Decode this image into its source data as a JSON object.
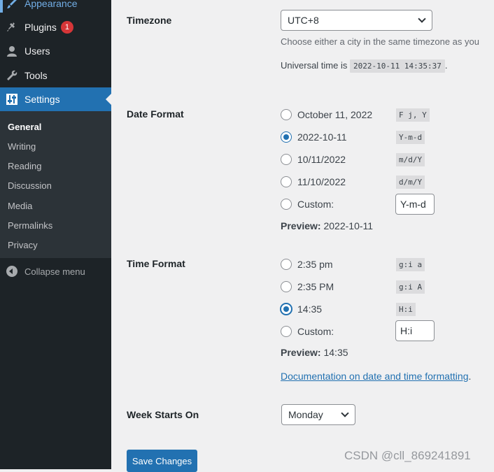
{
  "sidebar": {
    "appearance": "Appearance",
    "plugins": "Plugins",
    "plugins_badge": "1",
    "users": "Users",
    "tools": "Tools",
    "settings": "Settings",
    "submenu": [
      "General",
      "Writing",
      "Reading",
      "Discussion",
      "Media",
      "Permalinks",
      "Privacy"
    ],
    "collapse": "Collapse menu"
  },
  "timezone": {
    "label": "Timezone",
    "value": "UTC+8",
    "description": "Choose either a city in the same timezone as you",
    "universal_prefix": "Universal time is",
    "universal_time": "2022-10-11 14:35:37",
    "universal_suffix": "."
  },
  "date_format": {
    "label": "Date Format",
    "options": [
      {
        "label": "October 11, 2022",
        "code": "F j, Y",
        "checked": false
      },
      {
        "label": "2022-10-11",
        "code": "Y-m-d",
        "checked": true
      },
      {
        "label": "10/11/2022",
        "code": "m/d/Y",
        "checked": false
      },
      {
        "label": "11/10/2022",
        "code": "d/m/Y",
        "checked": false
      },
      {
        "label": "Custom:",
        "checked": false
      }
    ],
    "custom_value": "Y-m-d",
    "preview_label": "Preview:",
    "preview_value": "2022-10-11"
  },
  "time_format": {
    "label": "Time Format",
    "options": [
      {
        "label": "2:35 pm",
        "code": "g:i a",
        "checked": false
      },
      {
        "label": "2:35 PM",
        "code": "g:i A",
        "checked": false
      },
      {
        "label": "14:35",
        "code": "H:i",
        "checked": true
      },
      {
        "label": "Custom:",
        "checked": false
      }
    ],
    "custom_value": "H:i",
    "preview_label": "Preview:",
    "preview_value": "14:35"
  },
  "doc_link": {
    "text": "Documentation on date and time formatting",
    "suffix": "."
  },
  "week_starts": {
    "label": "Week Starts On",
    "value": "Monday"
  },
  "save_button": "Save Changes",
  "watermark": "CSDN @cll_869241891",
  "colors": {
    "sidebar_bg": "#1d2327",
    "submenu_bg": "#2c3338",
    "accent": "#2271b1",
    "badge": "#d63638",
    "page_bg": "#f0f0f1"
  }
}
